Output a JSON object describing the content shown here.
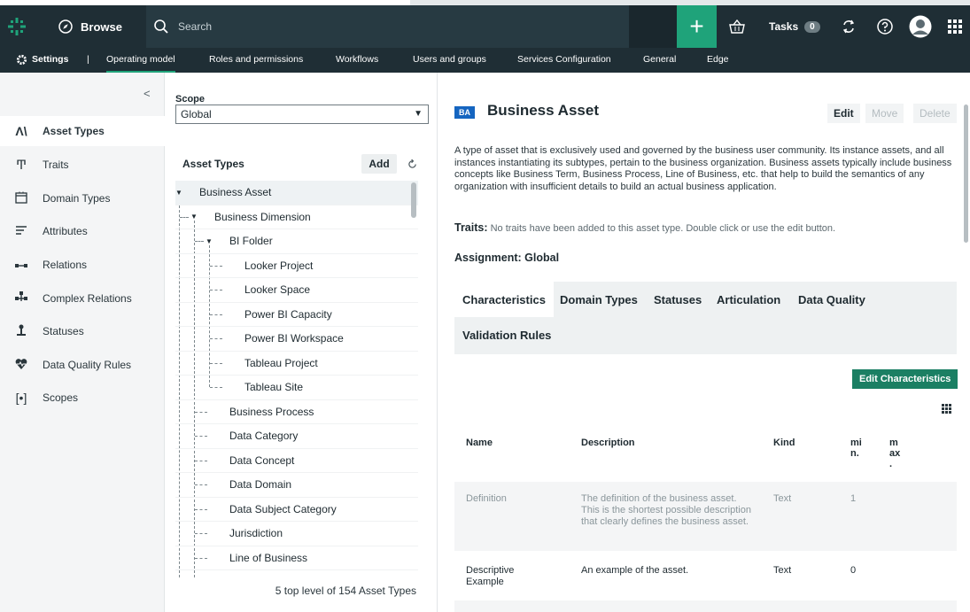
{
  "topbar": {
    "browse_label": "Browse",
    "search_placeholder": "Search",
    "tasks_label": "Tasks",
    "tasks_count": "0"
  },
  "settings_nav": {
    "settings_label": "Settings",
    "separator": "|",
    "items": [
      "Operating model",
      "Roles and permissions",
      "Workflows",
      "Users and groups",
      "Services Configuration",
      "General",
      "Edge"
    ]
  },
  "sidebar": {
    "collapse_glyph": "<",
    "items": [
      {
        "label": "Asset Types",
        "icon": "asset-types-icon"
      },
      {
        "label": "Traits",
        "icon": "traits-icon"
      },
      {
        "label": "Domain Types",
        "icon": "domain-types-icon"
      },
      {
        "label": "Attributes",
        "icon": "attributes-icon"
      },
      {
        "label": "Relations",
        "icon": "relations-icon"
      },
      {
        "label": "Complex Relations",
        "icon": "complex-relations-icon"
      },
      {
        "label": "Statuses",
        "icon": "statuses-icon"
      },
      {
        "label": "Data Quality Rules",
        "icon": "data-quality-icon"
      },
      {
        "label": "Scopes",
        "icon": "scopes-icon"
      }
    ]
  },
  "middle": {
    "scope_label": "Scope",
    "scope_value": "Global",
    "asset_types_header": "Asset Types",
    "add_label": "Add",
    "tree": [
      {
        "label": "Business Asset",
        "level": 0,
        "toggle": "▼"
      },
      {
        "label": "Business Dimension",
        "level": 1,
        "toggle": "▼"
      },
      {
        "label": "BI Folder",
        "level": 2,
        "toggle": "▼"
      },
      {
        "label": "Looker Project",
        "level": 3
      },
      {
        "label": "Looker Space",
        "level": 3
      },
      {
        "label": "Power BI Capacity",
        "level": 3
      },
      {
        "label": "Power BI Workspace",
        "level": 3
      },
      {
        "label": "Tableau Project",
        "level": 3
      },
      {
        "label": "Tableau Site",
        "level": 3
      },
      {
        "label": "Business Process",
        "level": 2
      },
      {
        "label": "Data Category",
        "level": 2
      },
      {
        "label": "Data Concept",
        "level": 2
      },
      {
        "label": "Data Domain",
        "level": 2
      },
      {
        "label": "Data Subject Category",
        "level": 2
      },
      {
        "label": "Jurisdiction",
        "level": 2
      },
      {
        "label": "Line of Business",
        "level": 2
      }
    ],
    "footer": "5 top level of 154 Asset Types"
  },
  "detail": {
    "badge": "BA",
    "title": "Business Asset",
    "edit_label": "Edit",
    "move_label": "Move",
    "delete_label": "Delete",
    "description": "A type of asset that is exclusively used and governed by the business user community. Its instance assets, and all instances instantiating its subtypes, pertain to the business organization. Business assets typically include business concepts like Business Term, Business Process, Line of Business, etc. that help to build the semantics of any organization with insufficient details to build an actual business application.",
    "traits_label": "Traits:",
    "traits_text": "No traits have been added to this asset type. Double click or use the edit button.",
    "assignment": "Assignment: Global",
    "tabs": [
      "Characteristics",
      "Domain Types",
      "Statuses",
      "Articulation",
      "Data Quality",
      "Validation Rules"
    ],
    "edit_characteristics": "Edit Characteristics",
    "table": {
      "headers": {
        "name": "Name",
        "description": "Description",
        "kind": "Kind",
        "min": "mi n.",
        "max": "m ax ."
      },
      "rows": [
        {
          "name": "Definition",
          "description": "The definition of the business asset. This is the shortest possible description that clearly defines the business asset.",
          "kind": "Text",
          "min": "1"
        },
        {
          "name": "Descriptive Example",
          "description": "An example of the asset.",
          "kind": "Text",
          "min": "0"
        }
      ]
    }
  },
  "colors": {
    "topbar": "#1f2e35",
    "accent": "#1fa37a",
    "badge": "#1565c0"
  }
}
